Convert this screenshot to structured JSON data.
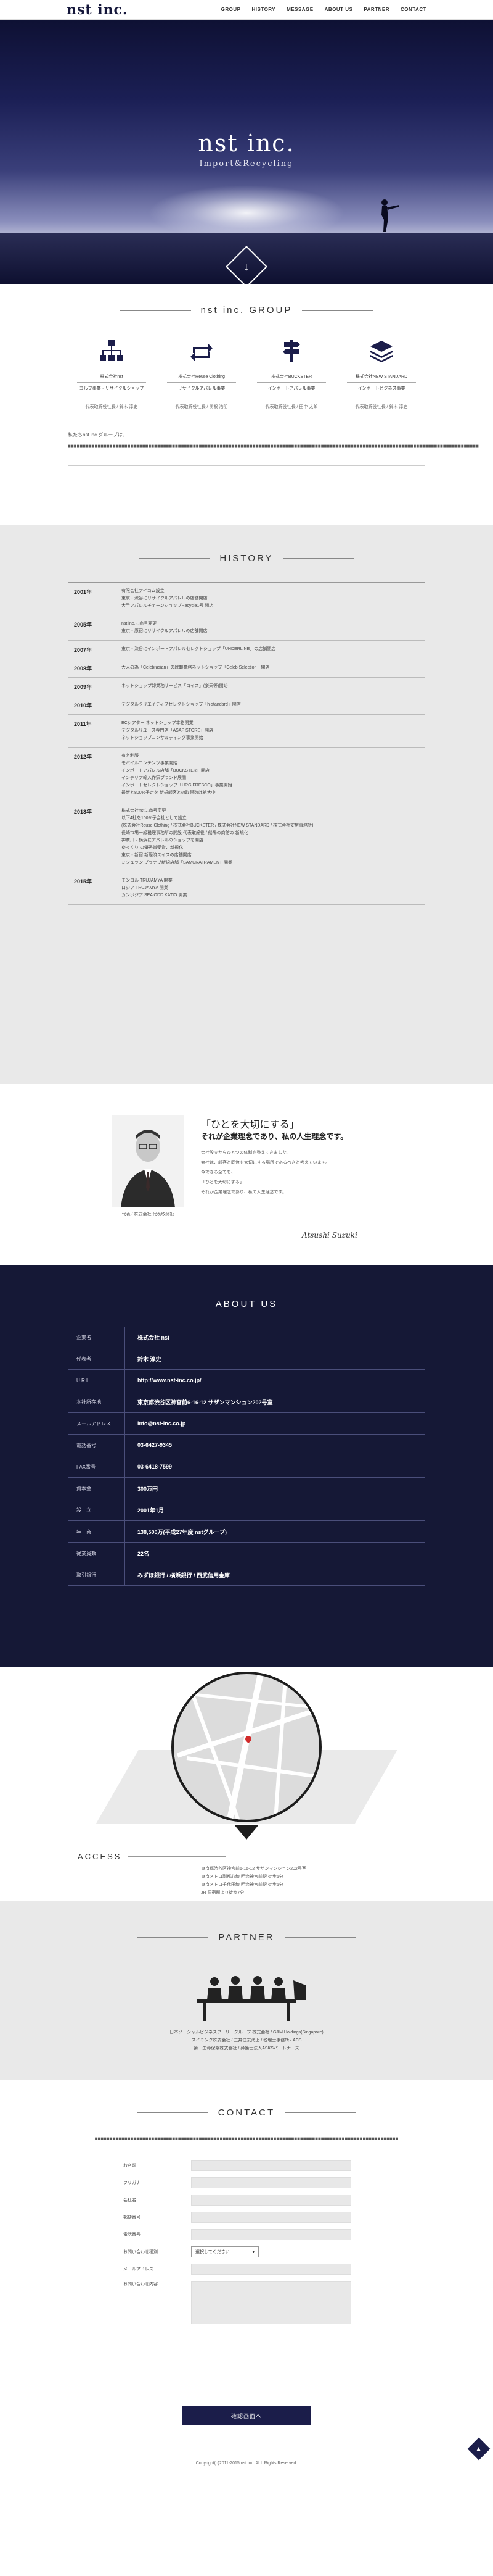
{
  "brand": "nst inc.",
  "tagline": "Import&Recycling",
  "nav": [
    "GROUP",
    "HISTORY",
    "MESSAGE",
    "ABOUT US",
    "PARTNER",
    "CONTACT"
  ],
  "group": {
    "title": "nst inc. GROUP",
    "items": [
      {
        "name": "株式会社nst",
        "cat": "ゴルフ事業・リサイクルショップ",
        "rep": "代表取締役社長 / 鈴木 淳史",
        "icon": "org-chart-icon"
      },
      {
        "name": "株式会社Reuse Clothing",
        "cat": "リサイクルアパレル事業",
        "rep": "代表取締役社長 / 関根 浩明",
        "icon": "recycle-arrows-icon"
      },
      {
        "name": "株式会社BUCKSTER",
        "cat": "インポートアパレル事業",
        "rep": "代表取締役社長 / 田中 太郎",
        "icon": "signpost-icon"
      },
      {
        "name": "株式会社NEW STANDARD",
        "cat": "インポートビジネス事業",
        "rep": "代表取締役社長 / 鈴木 淳史",
        "icon": "layers-icon"
      }
    ],
    "desc": "私たちnst inc.グループは、■■■■■■■■■■■■■■■■■■■■■■■■■■■■■■■■■■■■■■■■■■■■■■■■■■■■■■■■■■■■■■■■■■■■■■■■■■■■■■■■■■■■■■■■■■■■■■■■■■■■■■■■■■■■■■■■■■■■■■■■■■■■■■■■■■■■■■■■■■"
  },
  "history": {
    "title": "HISTORY",
    "rows": [
      {
        "year": "2001年",
        "events": [
          "有限会社アイコム設立",
          "東京・渋谷にリサイクルアパレルの店舗開店",
          "大手アパレルチェーンショップRecycle1号 開店"
        ]
      },
      {
        "year": "2005年",
        "events": [
          "nst inc.に商号変更",
          "東京・原宿にリサイクルアパレルの店舗開店"
        ]
      },
      {
        "year": "2007年",
        "events": [
          "東京・渋谷にインポートアパレルセレクトショップ「UNDERLINE」の店舗開店"
        ]
      },
      {
        "year": "2008年",
        "events": [
          "大人の為「Celebrasian」の靴卸業務ネットショップ「Celeb Selection」開店"
        ]
      },
      {
        "year": "2009年",
        "events": [
          "ネットショップ卸業務サービス「ロイス」(楽天等)開始"
        ]
      },
      {
        "year": "2010年",
        "events": [
          "デジタルクリエイティブセレクトショップ「h-standard」開店"
        ]
      },
      {
        "year": "2011年",
        "events": [
          "ECシアター ネットショップ本格開業",
          "デジタルリユース専門店「ASAP STORE」開店",
          "ネットショップコンサルティング事業開始"
        ]
      },
      {
        "year": "2012年",
        "events": [
          "有名制服",
          "モバイルコンテンツ事業開始",
          "インポートアパレル店舗「BUCKSTER」開店",
          "インテリア輸入作家ブランド展開",
          "インポートセレクトショップ「URG FRESCO」事業開始",
          "最新と800%予定を 新規顧客との取得数は拡大中"
        ]
      },
      {
        "year": "2013年",
        "events": [
          "株式会社nstに商号変更",
          "以下4社を100%子会社として設立",
          "(株式会社Reuse Clothing / 株式会社BUCKSTER / 株式会社NEW STANDARD / 株式会社安房事務所)",
          "長崎市場一級税理事務所の開設 代表取締役 / 船場の商館の 新規化",
          "神奈川・横浜にアパレルのショップを開店",
          "ゆっくり の優秀賞受賞、新規化",
          "東京・新宿 新経済スイスの店舗開店",
          "ミシュラン プラナブ新規店舗「SAMURAI RAMEN」開業"
        ]
      },
      {
        "year": "2015年",
        "events": [
          "モンゴル TRUJAMYA 開業",
          "ロシア TRUJAMYA 開業",
          "カンボジア SEA ODD KATIO 開業"
        ]
      }
    ]
  },
  "message": {
    "caption": "代表 / 株式会社 代表取締役",
    "quote": "「ひとを大切にする」",
    "quote2": "それが企業理念であり、私の人生理念です。",
    "lines": [
      "会社設立からひとつの体制を整えてきました。",
      "会社は、顧客と同僚を大切にする場所であるべきと考えています。",
      "今できる全てを、",
      "「ひとを大切にする」",
      "それが企業理念であり、私の人生理念です。"
    ],
    "sign": "Atsushi Suzuki"
  },
  "about": {
    "title": "ABOUT US",
    "rows": [
      {
        "k": "企業名",
        "v": "株式会社 nst"
      },
      {
        "k": "代表者",
        "v": "鈴木 淳史"
      },
      {
        "k": "U R L",
        "v": "http://www.nst-inc.co.jp/"
      },
      {
        "k": "本社所在地",
        "v": "東京都渋谷区神宮前6-16-12 サザンマンション202号室"
      },
      {
        "k": "メールアドレス",
        "v": "info@nst-inc.co.jp"
      },
      {
        "k": "電話番号",
        "v": "03-6427-9345"
      },
      {
        "k": "FAX番号",
        "v": "03-6418-7599"
      },
      {
        "k": "資本金",
        "v": "300万円"
      },
      {
        "k": "設　立",
        "v": "2001年1月"
      },
      {
        "k": "年　商",
        "v": "138,500万(平成27年度 nstグループ)"
      },
      {
        "k": "従業員数",
        "v": "22名"
      },
      {
        "k": "取引銀行",
        "v": "みずほ銀行 / 横浜銀行 / 西武信用金庫"
      }
    ]
  },
  "access": {
    "label": "ACCESS",
    "lines": [
      "東京都渋谷区神宮前6-16-12 サザンマンション202号室",
      "東京メトロ副都心線 明治神宮前駅 徒歩5分",
      "東京メトロ千代田線 明治神宮前駅 徒歩5分",
      "JR 原宿駅より徒歩7分"
    ]
  },
  "partner": {
    "title": "PARTNER",
    "lines": [
      "日本ソーシャルビジネスアーリーグループ 株式会社 / G&M Holdings(Singapore)",
      "スイミング株式会社 / 三井住友海上 / 税理士事務所 / ACS",
      "第一生命保険株式会社 / 弁護士法人ASKSパートナーズ"
    ]
  },
  "contact": {
    "title": "CONTACT",
    "intro": "■■■■■■■■■■■■■■■■■■■■■■■■■■■■■■■■■■■■■■■■■■■■■■■■■■■■■■■■■■■■■■■■■■■■■■■■■■■■■■■■■■■■■■■■■■■■■■■■■■■■■■",
    "fields": [
      "お名前",
      "フリガナ",
      "会社名",
      "郵便番号",
      "電話番号",
      "お問い合わせ種別",
      "メールアドレス",
      "お問い合わせ内容"
    ],
    "select": "選択してください",
    "submit": "確認画面へ",
    "copyright": "Copyright(c)2011-2015 nst inc. ALL Rights Reserved."
  },
  "colors": {
    "navy": "#151836",
    "accent": "#1b1d4a"
  }
}
